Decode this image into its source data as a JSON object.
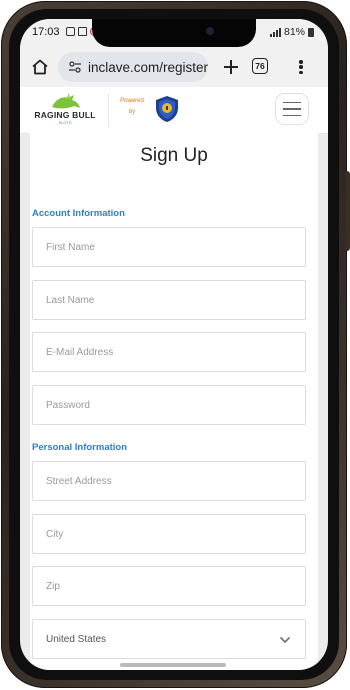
{
  "statusbar": {
    "time": "17:03",
    "battery": "81%"
  },
  "browser": {
    "url": "inclave.com/register",
    "tab_count": "76"
  },
  "header": {
    "logo_text": "RAGING BULL",
    "logo_subtext": "SLOTS",
    "powered_by_line1": "Powered",
    "powered_by_line2": "by"
  },
  "form": {
    "title": "Sign Up",
    "account_section": "Account Information",
    "personal_section": "Personal Information",
    "fields": {
      "first_name": "First Name",
      "last_name": "Last Name",
      "email": "E-Mail Address",
      "password": "Password",
      "street": "Street Address",
      "city": "City",
      "zip": "Zip",
      "country": "United States"
    }
  },
  "colors": {
    "accent": "#2f80c8",
    "powered_orange": "#e07b18",
    "frame": "#2a231d"
  }
}
